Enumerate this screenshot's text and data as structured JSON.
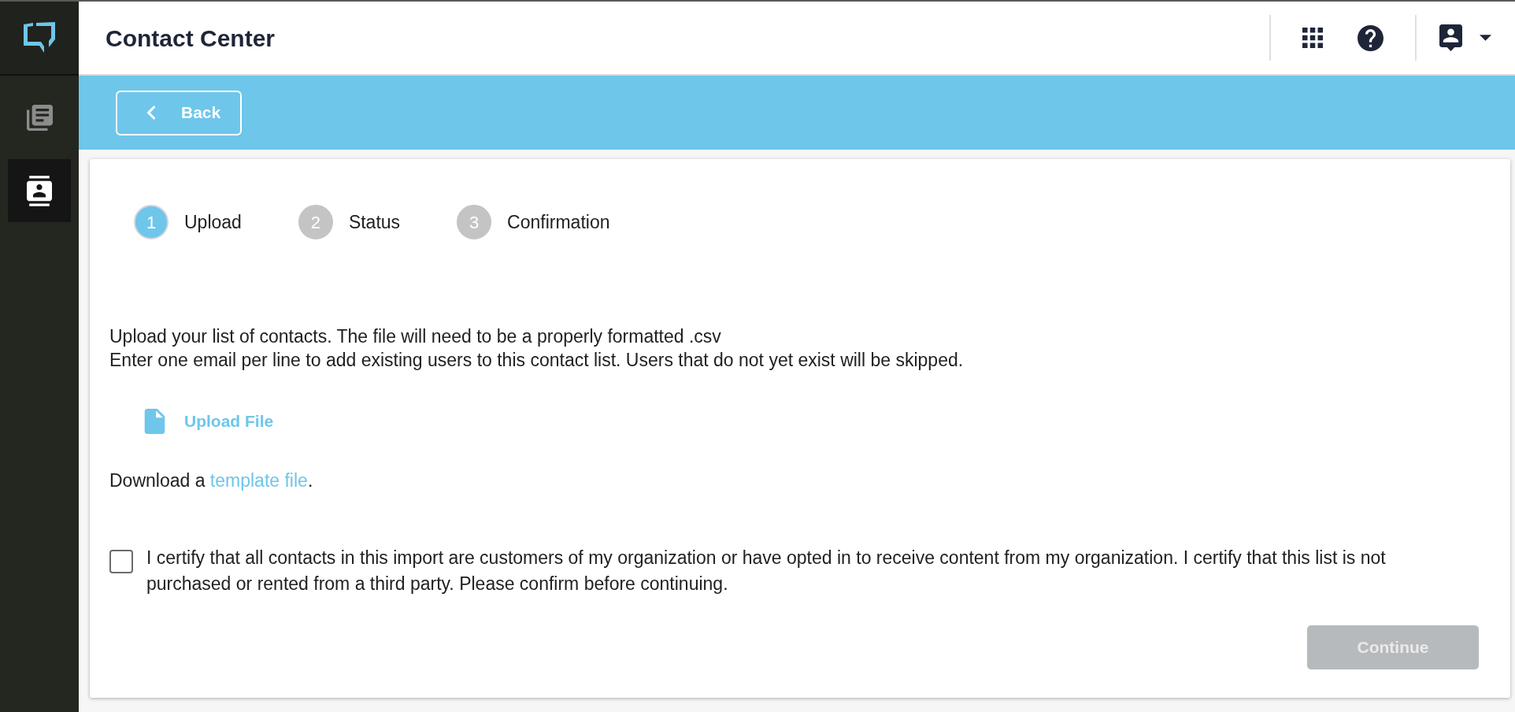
{
  "sidebar": {
    "items": [
      {
        "kind": "library",
        "selected": false
      },
      {
        "kind": "contacts",
        "selected": true
      }
    ]
  },
  "header": {
    "title": "Contact Center"
  },
  "toolbar": {
    "back_button": {
      "label": "Back"
    }
  },
  "stepper": {
    "steps": [
      {
        "number": "1",
        "label": "Upload",
        "selected": true
      },
      {
        "number": "2",
        "label": "Status",
        "selected": false
      },
      {
        "number": "3",
        "label": "Confirmation",
        "selected": false
      }
    ]
  },
  "instructions": [
    "Upload your list of contacts. The file will need to be a properly formatted .csv",
    "Enter one email per line to add existing users to this contact list. Users that do not yet exist will be skipped."
  ],
  "upload": {
    "label": "Upload File"
  },
  "download": {
    "prefix": "Download a ",
    "link": "template file",
    "suffix": "."
  },
  "certification": {
    "checked": false,
    "text": "I certify that all contacts in this import are customers of my organization or have opted in to receive content from my organization. I certify that this list is not purchased or rented from a third party. Please confirm before continuing."
  },
  "continue_button": {
    "label": "Continue",
    "disabled": true
  }
}
